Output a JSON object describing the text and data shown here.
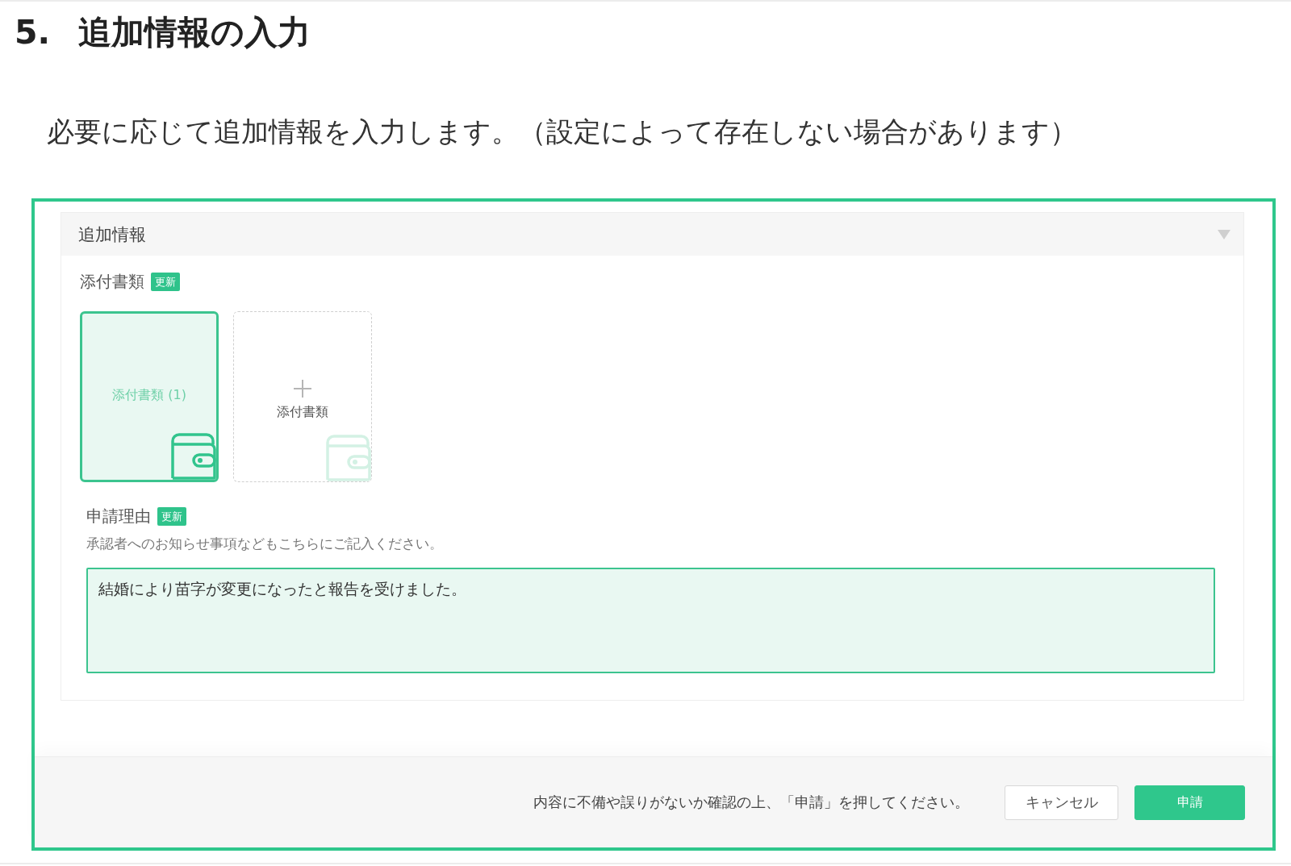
{
  "heading": {
    "number": "5.",
    "title": "追加情報の入力"
  },
  "intro": "必要に応じて追加情報を入力します。（設定によって存在しない場合があります）",
  "screenshot": {
    "panel": {
      "title": "追加情報",
      "attachments": {
        "label": "添付書類",
        "badge": "更新",
        "tiles": [
          {
            "kind": "file",
            "label": "添付書類 (1)"
          },
          {
            "kind": "add",
            "label": "添付書類"
          }
        ]
      },
      "reason": {
        "label": "申請理由",
        "badge": "更新",
        "hint": "承認者へのお知らせ事項などもこちらにご記入ください。",
        "value": "結婚により苗字が変更になったと報告を受けました。",
        "focused": true
      }
    },
    "footer": {
      "note": "内容に不備や誤りがないか確認の上、「申請」を押してください。",
      "buttons": [
        {
          "kind": "secondary",
          "label": "キャンセル"
        },
        {
          "kind": "primary",
          "label": "申請"
        }
      ]
    }
  }
}
